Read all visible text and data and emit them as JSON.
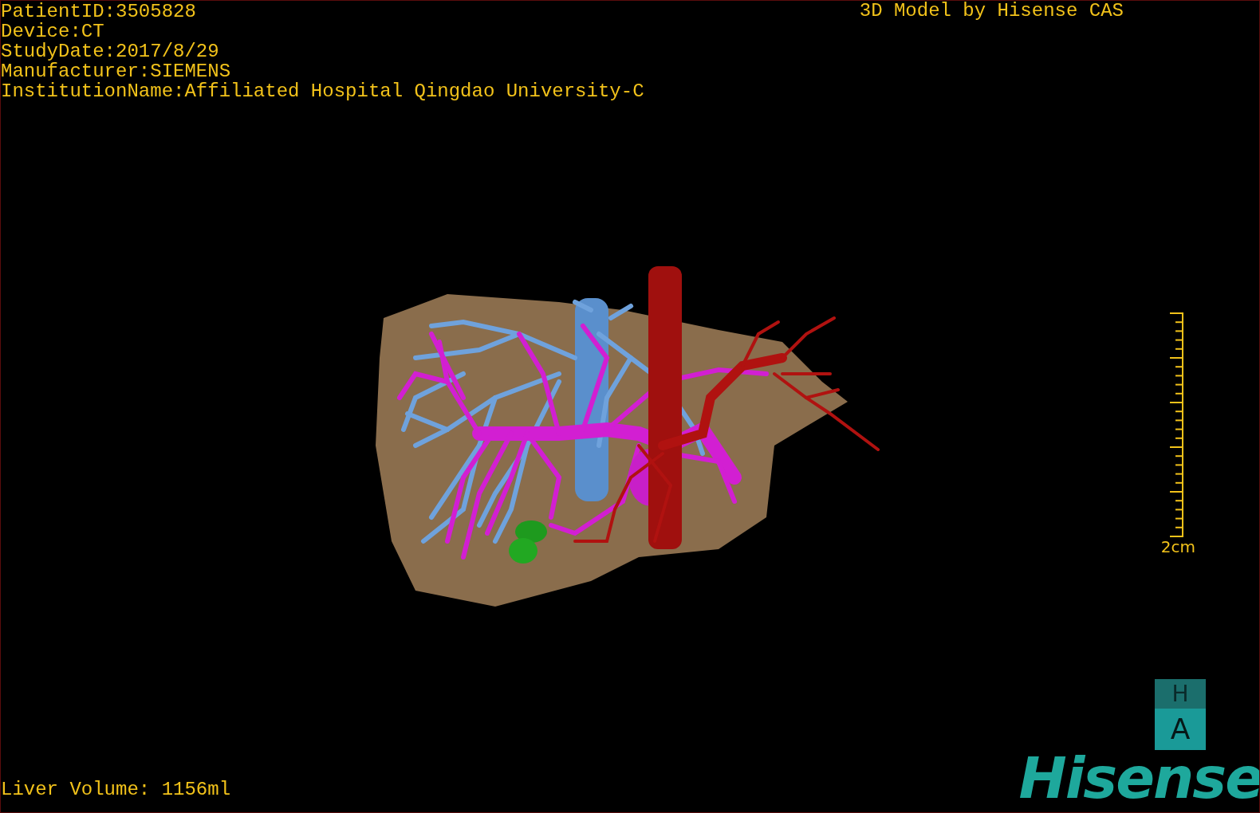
{
  "info": [
    "PatientID:3505828",
    "Device:CT",
    "StudyDate:2017/8/29",
    "Manufacturer:SIEMENS",
    "InstitutionName:Affiliated Hospital Qingdao University-C"
  ],
  "title": "3D Model by Hisense CAS",
  "scale": {
    "label": "2cm"
  },
  "orientation": {
    "top": "H",
    "front": "A"
  },
  "volume": "Liver Volume: 1156ml",
  "logo": "Hisense"
}
